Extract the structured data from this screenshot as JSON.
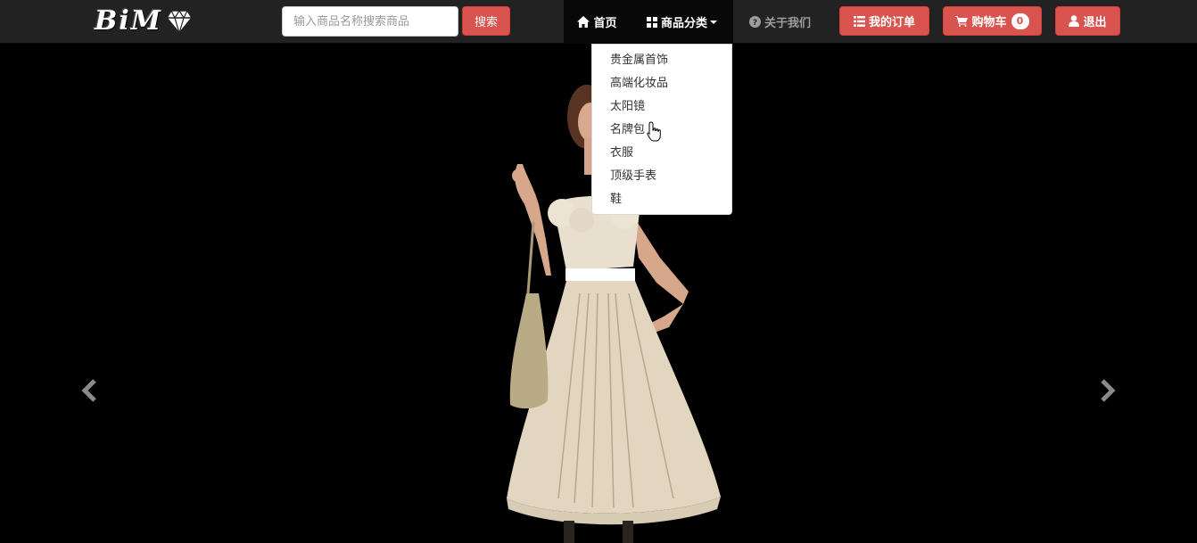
{
  "brand": {
    "logo_text": "BiM",
    "logo_icon": "diamond-icon"
  },
  "search": {
    "placeholder": "输入商品名称搜索商品",
    "value": "",
    "button_label": "搜索"
  },
  "nav": {
    "home": {
      "label": "首页",
      "icon": "home-icon"
    },
    "categories": {
      "label": "商品分类",
      "icon": "grid-icon"
    },
    "about": {
      "label": "关于我们",
      "icon": "question-circle-icon"
    }
  },
  "actions": {
    "orders": {
      "label": "我的订单",
      "icon": "list-icon"
    },
    "cart": {
      "label": "购物车",
      "icon": "cart-icon",
      "count": "0"
    },
    "logout": {
      "label": "退出",
      "icon": "user-icon"
    }
  },
  "dropdown": {
    "items": [
      "贵金属首饰",
      "高端化妆品",
      "太阳镜",
      "名牌包",
      "衣服",
      "顶级手表",
      "鞋"
    ]
  },
  "carousel": {
    "prev_icon": "chevron-left-icon",
    "next_icon": "chevron-right-icon"
  },
  "colors": {
    "navbar_bg": "#222222",
    "active_nav_bg": "#080808",
    "danger": "#d9534f",
    "carousel_bg": "#000000"
  }
}
